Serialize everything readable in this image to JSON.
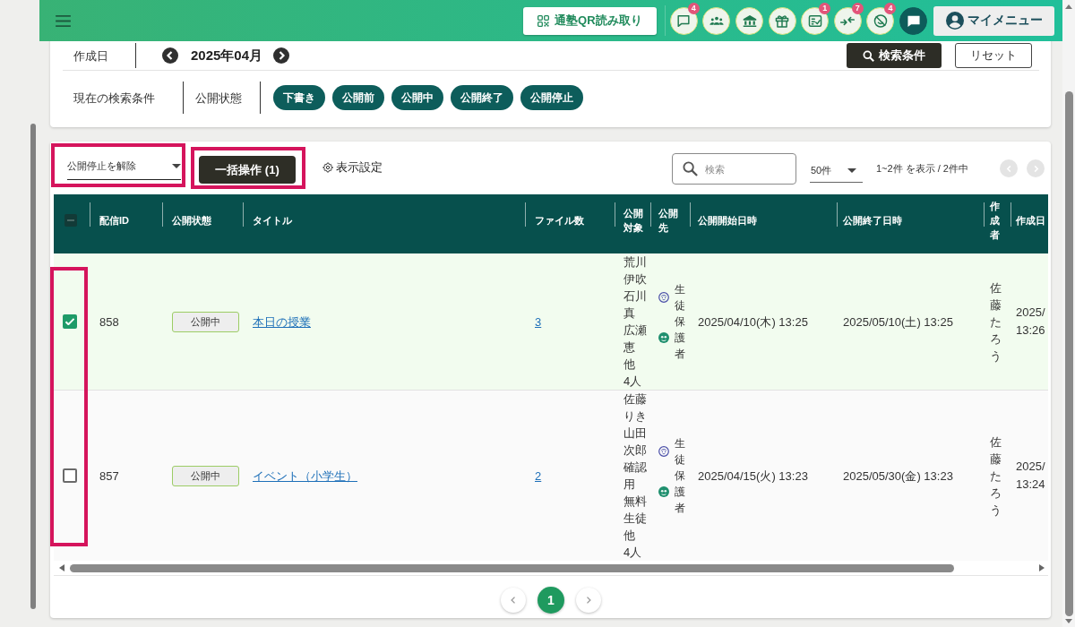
{
  "header": {
    "qr_button": "通塾QR読み取り",
    "icon_buttons": [
      {
        "kind": "comment",
        "badge": "4"
      },
      {
        "kind": "people"
      },
      {
        "kind": "building"
      },
      {
        "kind": "gift"
      },
      {
        "kind": "checklist",
        "badge": "1"
      },
      {
        "kind": "merge",
        "badge": "7"
      },
      {
        "kind": "hidden",
        "badge": "4"
      },
      {
        "kind": "chat"
      }
    ],
    "my_menu": "マイメニュー"
  },
  "search": {
    "date_label": "作成日",
    "month": "2025年04月",
    "search_button": "検索条件",
    "reset_button": "リセット",
    "conditions_label": "現在の検索条件",
    "state_label": "公開状態",
    "state_chips": [
      "下書き",
      "公開前",
      "公開中",
      "公開終了",
      "公開停止"
    ]
  },
  "toolbar": {
    "bulk_select": {
      "value": "公開停止を解除",
      "highlighted": true
    },
    "bulk_button": {
      "label": "一括操作 (1)",
      "highlighted": true
    },
    "display_settings": "表示設定",
    "search": {
      "placeholder": "検索"
    },
    "page_size": "50件",
    "range": "1~2件 を表示 / 2件中",
    "prev_page": {
      "disabled": true
    },
    "next_page": {
      "disabled": true
    }
  },
  "table": {
    "select_all": {
      "indeterminate": true
    },
    "checkbox_column_highlighted": true,
    "columns": [
      "配信ID",
      "公開状態",
      "タイトル",
      "ファイル数",
      "公開対象",
      "公開先",
      "公開開始日時",
      "公開終了日時",
      "作成者",
      "作成日"
    ],
    "rows": [
      {
        "checked": true,
        "id": "858",
        "status": "公開中",
        "title": "本日の授業",
        "files": "3",
        "targets": [
          "荒川伊吹",
          "石川真",
          "広瀬恵",
          "他 4人"
        ],
        "audiences": [
          {
            "kind": "student",
            "label": "生徒"
          },
          {
            "kind": "guardian",
            "label": "保護者"
          }
        ],
        "start": "2025/04/10(木) 13:25",
        "end": "2025/05/10(土) 13:25",
        "author": "佐藤たろう",
        "created": "2025/ 13:26"
      },
      {
        "checked": false,
        "id": "857",
        "status": "公開中",
        "title": "イベント（小学生）",
        "files": "2",
        "targets": [
          "佐藤りき",
          "山田次郎",
          "確認用",
          "無料生徒",
          "他 4人"
        ],
        "audiences": [
          {
            "kind": "student",
            "label": "生徒"
          },
          {
            "kind": "guardian",
            "label": "保護者"
          }
        ],
        "start": "2025/04/15(火) 13:23",
        "end": "2025/05/30(金) 13:23",
        "author": "佐藤たろう",
        "created": "2025/ 13:24"
      }
    ]
  },
  "pagination": {
    "pages": [
      {
        "label": "1",
        "selected": true
      }
    ]
  }
}
